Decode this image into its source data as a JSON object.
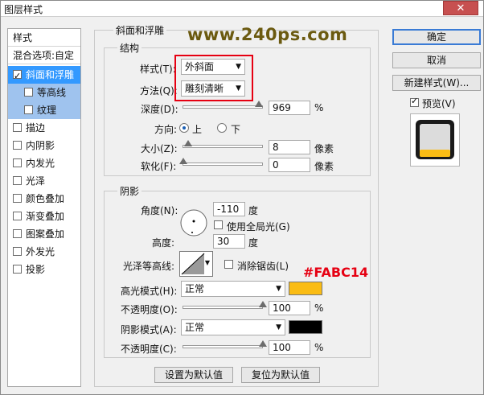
{
  "window": {
    "title": "图层样式",
    "close_icon": "close-icon"
  },
  "watermark": "www.240ps.com",
  "annotation": {
    "text": "#FABC14",
    "color": "#e60012"
  },
  "left": {
    "header": "样式",
    "blend": "混合选项:自定",
    "items": [
      {
        "label": "斜面和浮雕",
        "checked": true
      },
      {
        "label": "等高线",
        "checked": false
      },
      {
        "label": "纹理",
        "checked": false
      },
      {
        "label": "描边",
        "checked": false
      },
      {
        "label": "内阴影",
        "checked": false
      },
      {
        "label": "内发光",
        "checked": false
      },
      {
        "label": "光泽",
        "checked": false
      },
      {
        "label": "颜色叠加",
        "checked": false
      },
      {
        "label": "渐变叠加",
        "checked": false
      },
      {
        "label": "图案叠加",
        "checked": false
      },
      {
        "label": "外发光",
        "checked": false
      },
      {
        "label": "投影",
        "checked": false
      }
    ]
  },
  "bevel": {
    "title": "斜面和浮雕",
    "structure": {
      "title": "结构",
      "style_label": "样式(T):",
      "style_value": "外斜面",
      "technique_label": "方法(Q):",
      "technique_value": "雕刻清晰",
      "depth_label": "深度(D):",
      "depth_value": "969",
      "depth_unit": "%",
      "direction_label": "方向:",
      "dir_up": "上",
      "dir_down": "下",
      "size_label": "大小(Z):",
      "size_value": "8",
      "size_unit": "像素",
      "soften_label": "软化(F):",
      "soften_value": "0",
      "soften_unit": "像素"
    },
    "shading": {
      "title": "阴影",
      "angle_label": "角度(N):",
      "angle_value": "-110",
      "angle_unit": "度",
      "global_light": "使用全局光(G)",
      "altitude_label": "高度:",
      "altitude_value": "30",
      "altitude_unit": "度",
      "gloss_label": "光泽等高线:",
      "anti_alias": "消除锯齿(L)",
      "highlight_label": "高光模式(H):",
      "highlight_mode": "正常",
      "highlight_color": "#FABC14",
      "hl_opacity_label": "不透明度(O):",
      "hl_opacity_value": "100",
      "hl_opacity_unit": "%",
      "shadow_label": "阴影模式(A):",
      "shadow_mode": "正常",
      "shadow_color": "#000000",
      "sh_opacity_label": "不透明度(C):",
      "sh_opacity_value": "100",
      "sh_opacity_unit": "%"
    },
    "make_default": "设置为默认值",
    "reset_default": "复位为默认值"
  },
  "right": {
    "ok": "确定",
    "cancel": "取消",
    "new_style": "新建样式(W)...",
    "preview": "预览(V)"
  }
}
